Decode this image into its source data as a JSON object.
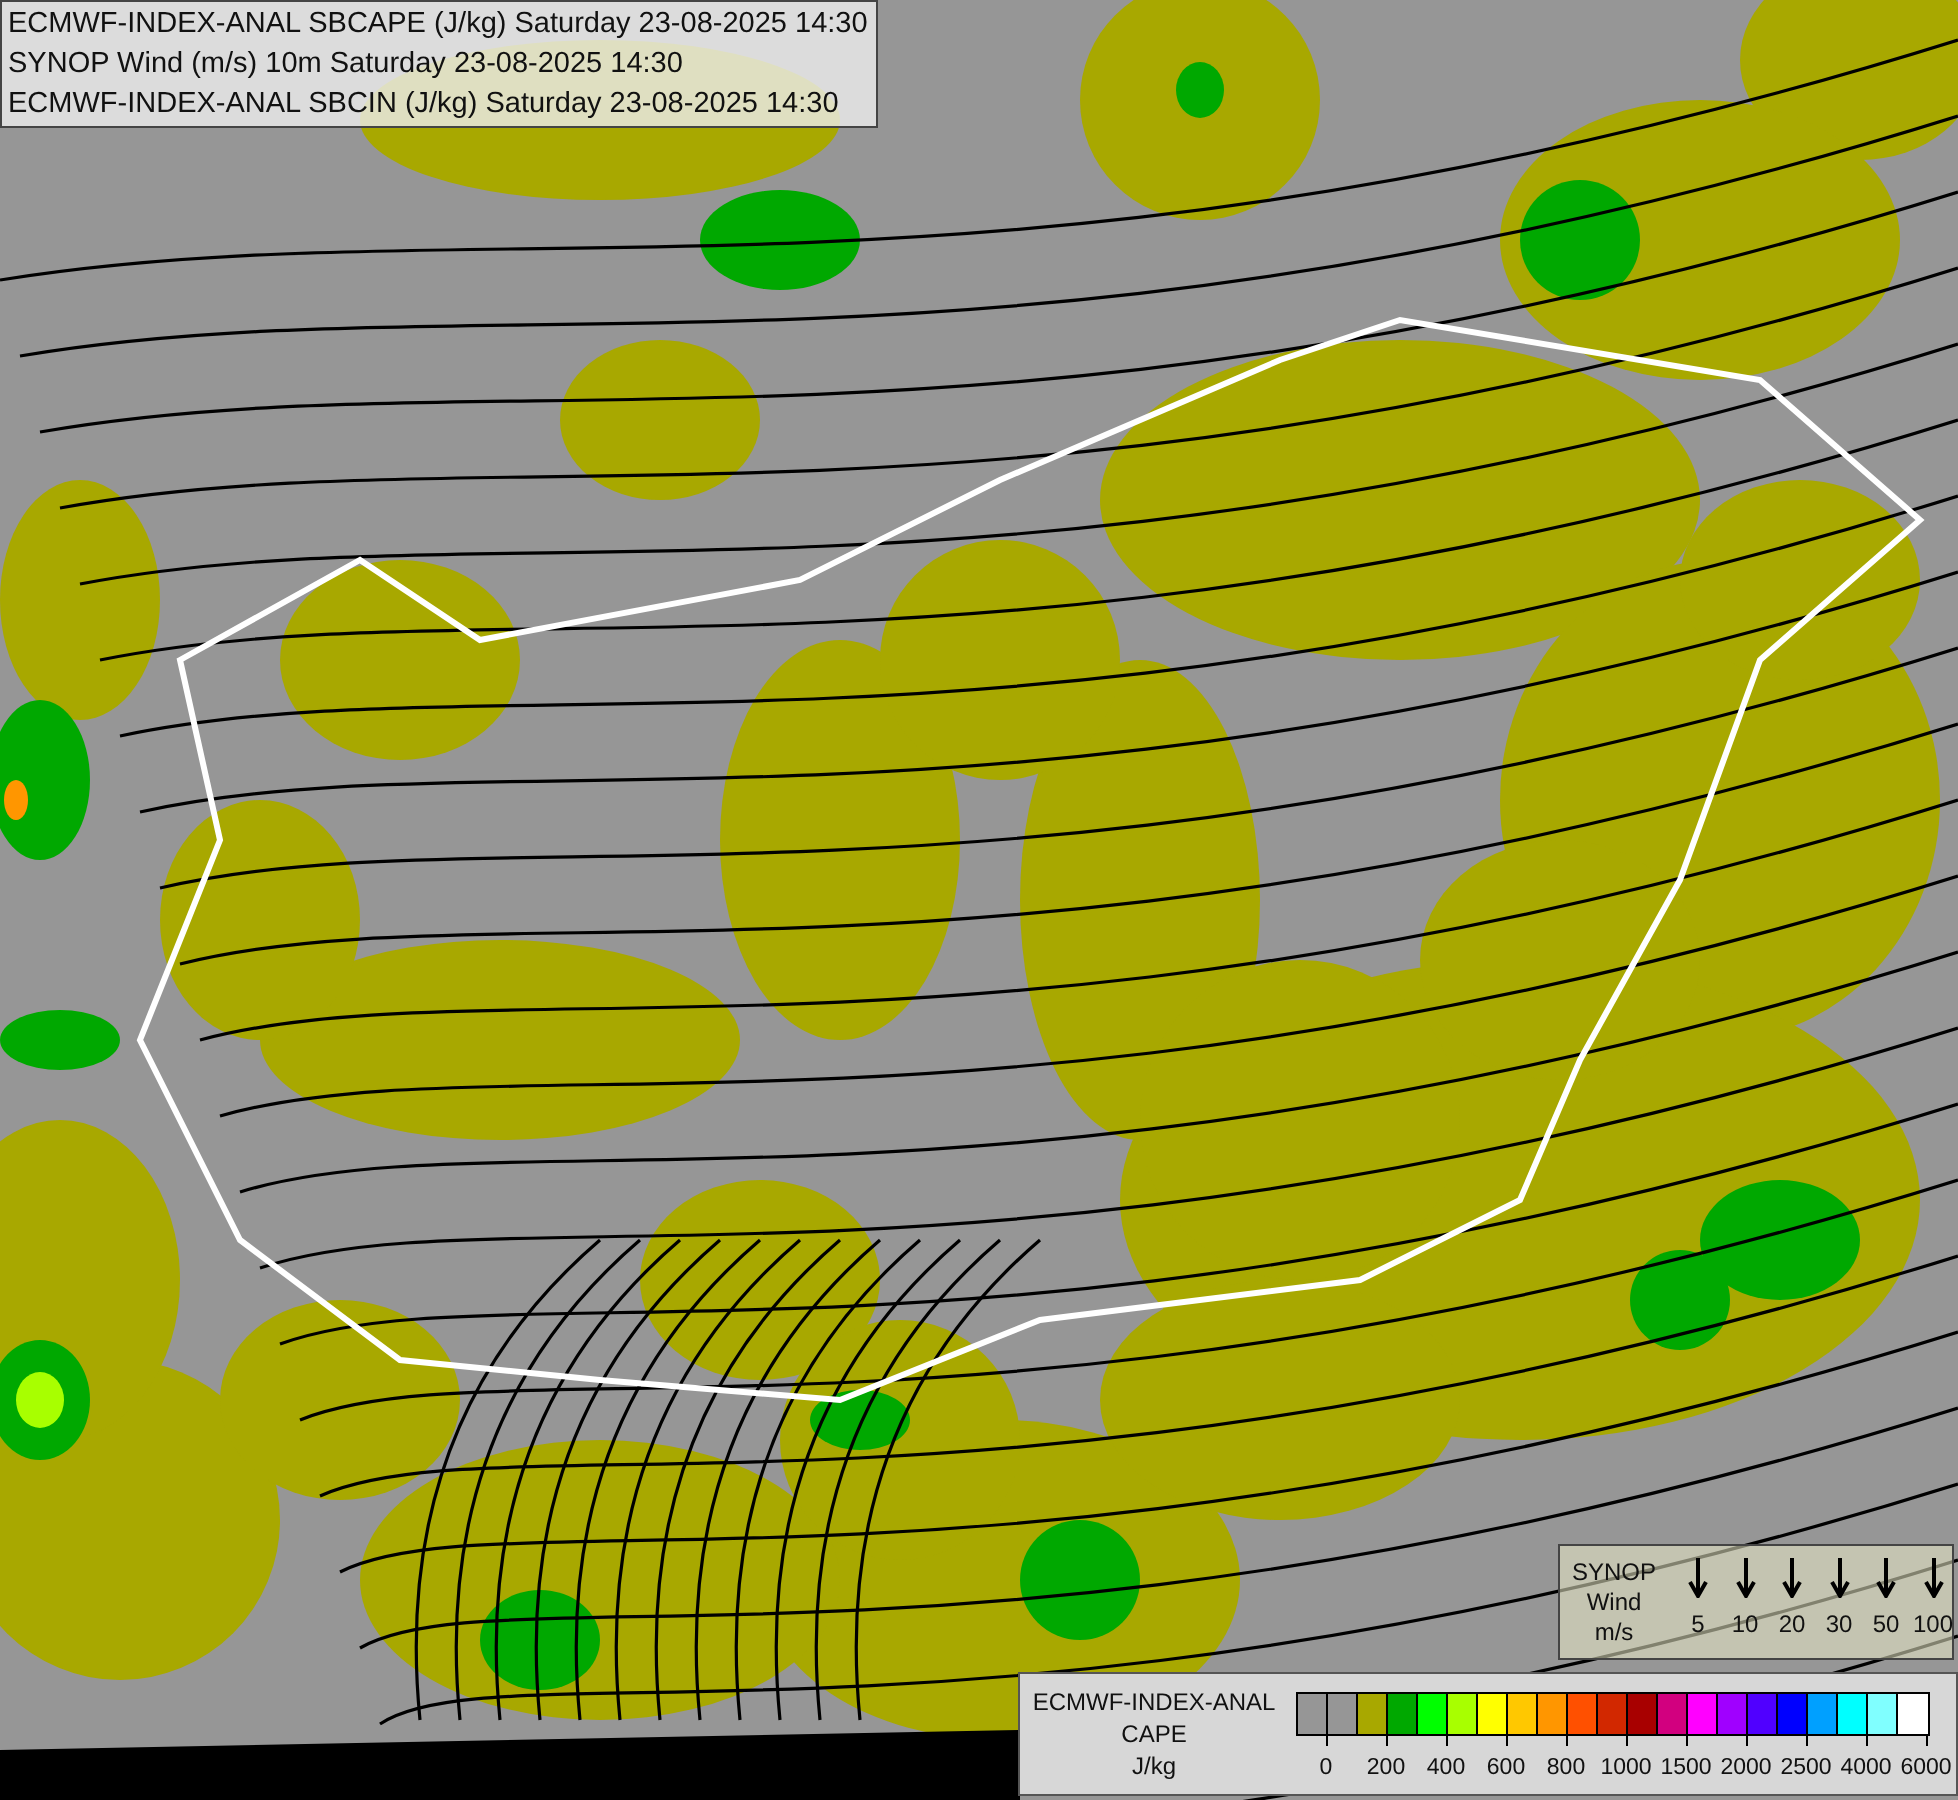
{
  "title_lines": [
    "ECMWF-INDEX-ANAL SBCAPE (J/kg) Saturday 23-08-2025 14:30",
    "SYNOP Wind (m/s) 10m Saturday 23-08-2025 14:30",
    "ECMWF-INDEX-ANAL SBCIN (J/kg) Saturday 23-08-2025 14:30"
  ],
  "wind_legend": {
    "title_lines": [
      "SYNOP",
      "Wind",
      "m/s"
    ],
    "speeds": [
      "5",
      "10",
      "20",
      "30",
      "50",
      "100"
    ]
  },
  "cape_legend": {
    "title_lines": [
      "ECMWF-INDEX-ANAL",
      "CAPE",
      "J/kg"
    ],
    "swatches": [
      {
        "color": "#969696"
      },
      {
        "color": "#969696"
      },
      {
        "color": "#a8a800"
      },
      {
        "color": "#00a800"
      },
      {
        "color": "#00ff00"
      },
      {
        "color": "#a8ff00"
      },
      {
        "color": "#ffff00"
      },
      {
        "color": "#ffc800"
      },
      {
        "color": "#ff9600"
      },
      {
        "color": "#ff5000"
      },
      {
        "color": "#d22800"
      },
      {
        "color": "#a80000"
      },
      {
        "color": "#d2007f"
      },
      {
        "color": "#ff00ff"
      },
      {
        "color": "#a000ff"
      },
      {
        "color": "#5000ff"
      },
      {
        "color": "#0000ff"
      },
      {
        "color": "#00a0ff"
      },
      {
        "color": "#00ffff"
      },
      {
        "color": "#80ffff"
      },
      {
        "color": "#ffffff"
      }
    ],
    "ticks": [
      "0",
      "200",
      "400",
      "600",
      "800",
      "1000",
      "1500",
      "2000",
      "2500",
      "4000",
      "6000"
    ]
  }
}
